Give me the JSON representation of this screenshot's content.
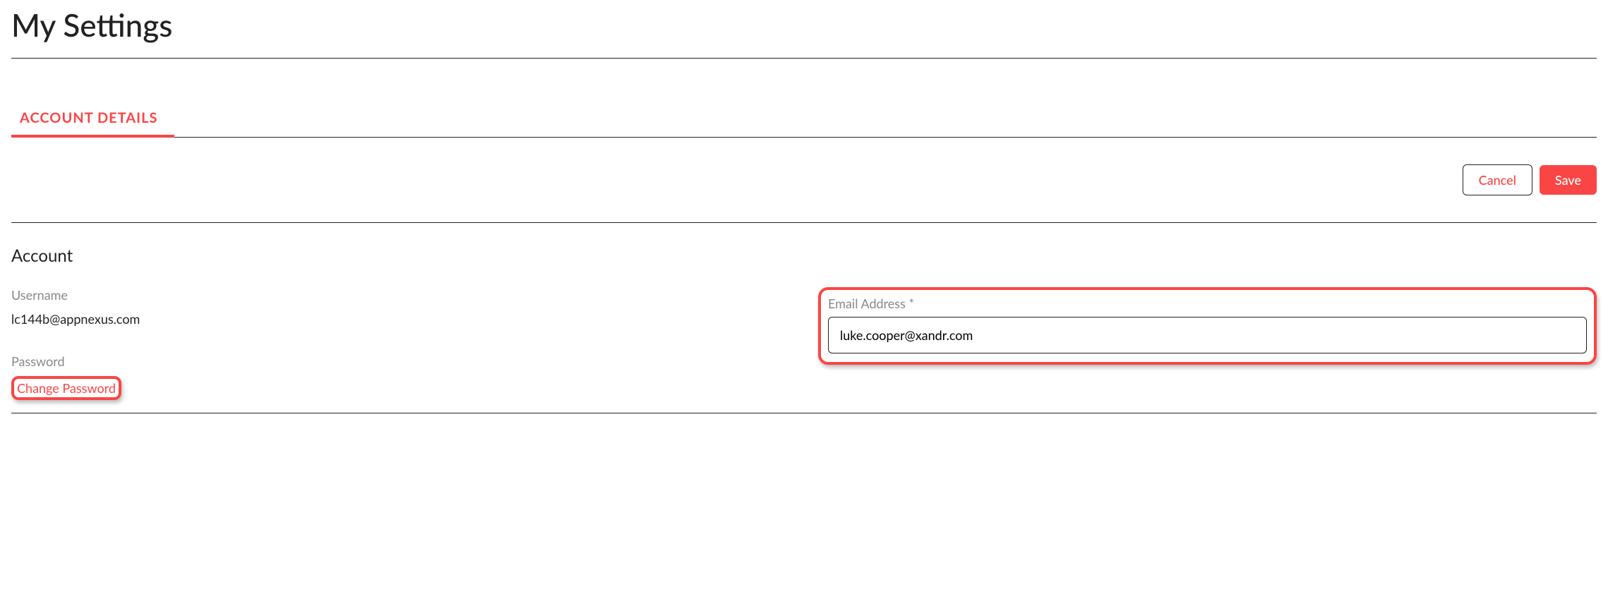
{
  "page": {
    "title": "My Settings"
  },
  "tabs": {
    "account_details": "ACCOUNT DETAILS"
  },
  "actions": {
    "cancel": "Cancel",
    "save": "Save"
  },
  "section": {
    "title": "Account"
  },
  "fields": {
    "username_label": "Username",
    "username_value": "lc144b@appnexus.com",
    "email_label": "Email Address *",
    "email_value": "luke.cooper@xandr.com",
    "password_label": "Password",
    "change_password": "Change Password"
  },
  "colors": {
    "accent": "#fa4545"
  }
}
